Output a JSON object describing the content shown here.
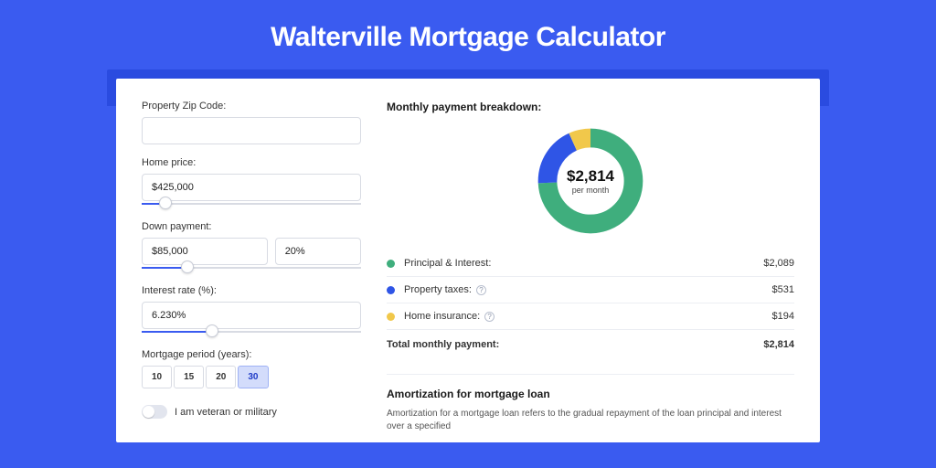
{
  "title": "Walterville Mortgage Calculator",
  "form": {
    "zip_label": "Property Zip Code:",
    "zip_value": "",
    "home_price_label": "Home price:",
    "home_price_value": "$425,000",
    "down_payment_label": "Down payment:",
    "down_payment_value": "$85,000",
    "down_payment_pct": "20%",
    "interest_label": "Interest rate (%):",
    "interest_value": "6.230%",
    "period_label": "Mortgage period (years):",
    "periods": [
      "10",
      "15",
      "20",
      "30"
    ],
    "period_selected": "30",
    "veteran_label": "I am veteran or military"
  },
  "breakdown": {
    "title": "Monthly payment breakdown:",
    "center_amount": "$2,814",
    "center_sub": "per month",
    "items": [
      {
        "label": "Principal & Interest:",
        "value": "$2,089"
      },
      {
        "label": "Property taxes:",
        "value": "$531"
      },
      {
        "label": "Home insurance:",
        "value": "$194"
      }
    ],
    "total_label": "Total monthly payment:",
    "total_value": "$2,814"
  },
  "chart_data": {
    "type": "pie",
    "title": "Monthly payment breakdown",
    "series": [
      {
        "name": "Principal & Interest",
        "value": 2089,
        "color": "#3fae7d"
      },
      {
        "name": "Property taxes",
        "value": 531,
        "color": "#2f55e6"
      },
      {
        "name": "Home insurance",
        "value": 194,
        "color": "#f1c84b"
      }
    ],
    "total": 2814
  },
  "amortization": {
    "title": "Amortization for mortgage loan",
    "text": "Amortization for a mortgage loan refers to the gradual repayment of the loan principal and interest over a specified"
  },
  "colors": {
    "accent": "#3a5bf0",
    "green": "#3fae7d",
    "blue": "#2f55e6",
    "yellow": "#f1c84b"
  }
}
